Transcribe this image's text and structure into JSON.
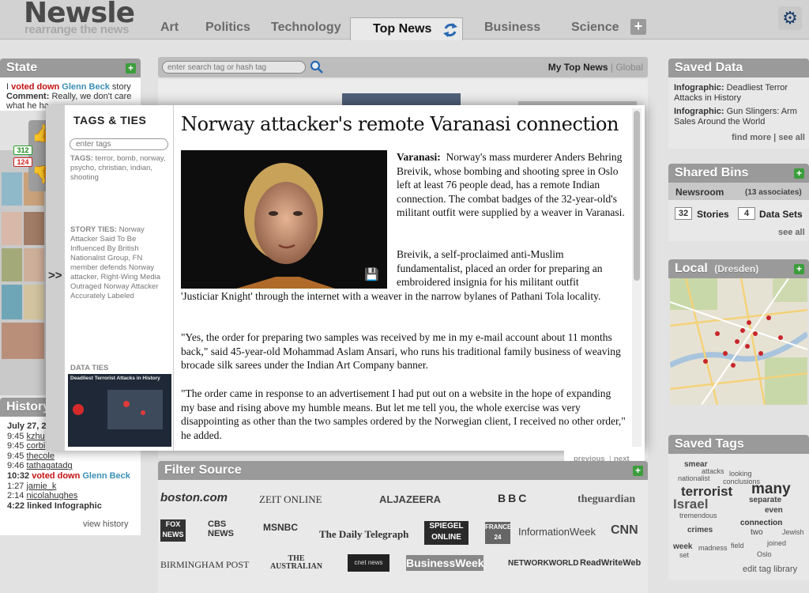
{
  "header": {
    "logo": "Newsle",
    "tagline": "rearrange the news",
    "tabs": [
      "Art",
      "Politics",
      "Technology",
      "Top News",
      "Business",
      "Science"
    ],
    "active_tab": "Top News",
    "add_tab": "+"
  },
  "state": {
    "title": "State",
    "actor": "I",
    "action": "voted down",
    "target": "Glenn Beck",
    "object": "story",
    "comment_label": "Comment:",
    "comment_text": "Really, we don't care",
    "comment_cont": "what he ha",
    "votes_up": "312",
    "votes_down": "124"
  },
  "search": {
    "placeholder": "enter search tag or hash tag",
    "scope_my": "My Top News",
    "sep": "|",
    "scope_global": "Global"
  },
  "modal": {
    "sidebar_title": "TAGS & TIES",
    "tag_placeholder": "enter tags",
    "tags_label": "TAGS:",
    "tags": "terror, bomb, norway, psycho, christian, indian, shooting",
    "story_ties_label": "STORY TIES:",
    "story_ties": "Norway Attacker Said To Be Influenced By British Nationalist Group, FN member defends Norway attacker, Right-Wing Media Outraged Norway Attacker Accurately Labeled",
    "data_ties_label": "DATA TIES",
    "data_ties_thumb": "Deadliest Terrorist Attacks in History",
    "expand": ">>",
    "title": "Norway attacker's remote Varanasi connection",
    "dateline": "Varanasi:",
    "p1": "Norway's mass murderer Anders Behring Breivik, whose bombing and shooting spree in Oslo left at least 76 people dead, has a remote Indian connection. The combat badges of the 32-year-old's militant outfit were supplied by a weaver in Varanasi.",
    "p2a": "Breivik, a self-proclaimed anti-Muslim fundamentalist, placed an order for preparing an embroidered insignia for his militant outfit",
    "p2b": "'Justiciar Knight' through the internet with a weaver in the narrow bylanes of Pathani Tola locality.",
    "p3": "\"Yes, the order for preparing two samples was received by me in my e-mail account about 11 months back,\" said 45-year-old Mohammad Aslam Ansari, who runs his traditional family business of weaving brocade silk sarees under the Indian Art Company banner.",
    "p4": "\"The order came in response to an advertisement I had put out on a website in the hope of expanding my base and rising above my humble means. But let me tell you, the whole exercise was very disappointing as other than the two samples ordered by the Norwegian client, I received no other order,\" he added.",
    "previous": "previous",
    "next": "next",
    "pager_sep": "|"
  },
  "saved_data": {
    "title": "Saved Data",
    "items": [
      {
        "label": "Infographic:",
        "text": "Deadliest Terror Attacks in History"
      },
      {
        "label": "Infographic:",
        "text": "Gun Slingers: Arm Sales Around the World"
      }
    ],
    "find_more": "find more",
    "see_all": "see all"
  },
  "shared_bins": {
    "title": "Shared Bins",
    "bin": "Newsroom",
    "associates": "(13 associates)",
    "stories_count": "32",
    "stories_label": "Stories",
    "datasets_count": "4",
    "datasets_label": "Data Sets",
    "see_all": "see all"
  },
  "local": {
    "title": "Local",
    "place": "(Dresden)"
  },
  "saved_tags": {
    "title": "Saved Tags",
    "edit": "edit tag library",
    "cloud": [
      "terrorist",
      "many",
      "Israel",
      "smear",
      "attacks",
      "nationalist",
      "looking",
      "conclusions",
      "separate",
      "tremendous",
      "even",
      "connection",
      "two",
      "crimes",
      "week",
      "set",
      "madness",
      "field",
      "joined",
      "Jewish",
      "Oslo"
    ]
  },
  "history": {
    "title": "History",
    "date": "July 27, 2",
    "rows": [
      {
        "time": "9:45",
        "user": "kzhu",
        "rest": ""
      },
      {
        "time": "9:45",
        "user": "corbi",
        "rest": ""
      },
      {
        "time": "9:45",
        "user": "thecole",
        "rest": ""
      },
      {
        "time": "9:46",
        "user": "tathagatadg",
        "rest": ""
      },
      {
        "time": "10:32",
        "user": "",
        "rest": "voted down",
        "target": "Glenn Beck"
      },
      {
        "time": "1:27",
        "user": "jamie_k",
        "rest": ""
      },
      {
        "time": "2:14",
        "user": "nicolahughes",
        "rest": ""
      },
      {
        "time": "4:22",
        "user": "",
        "rest": "linked Infographic"
      }
    ],
    "view": "view history"
  },
  "filter_source": {
    "title": "Filter Source",
    "row1": [
      "boston.com",
      "ZEIT ONLINE",
      "ALJAZEERA",
      "BBC",
      "theguardian"
    ],
    "row2": [
      "FOX NEWS",
      "CBS NEWS",
      "MSNBC",
      "The Daily Telegraph",
      "SPIEGEL ONLINE",
      "FRANCE 24",
      "InformationWeek",
      "CNN"
    ],
    "row3": [
      "BIRMINGHAM POST",
      "THE AUSTRALIAN",
      "cnet news",
      "BusinessWeek",
      "NETWORKWORLD",
      "ReadWriteWeb"
    ]
  },
  "colors": {
    "accent_red": "#c31212",
    "accent_blue": "#3b8fb5",
    "plus_green": "#3c9d3c",
    "panel_head": "#9a9a9a"
  }
}
